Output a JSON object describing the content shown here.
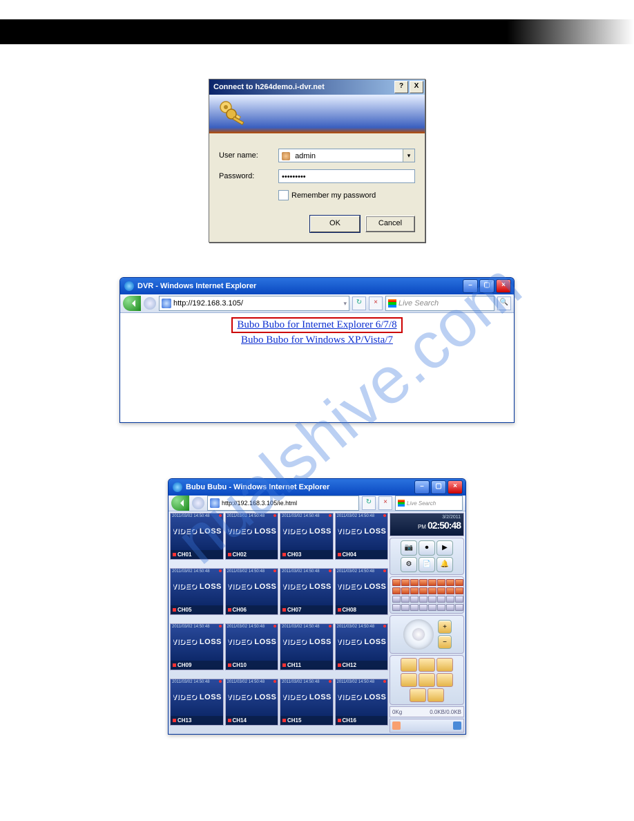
{
  "connect_dialog": {
    "title": "Connect to h264demo.i-dvr.net",
    "help_btn": "?",
    "close_btn": "X",
    "username_label": "User name:",
    "username_value": "admin",
    "password_label": "Password:",
    "password_value": "•••••••••",
    "remember_label": "Remember my password",
    "ok_label": "OK",
    "cancel_label": "Cancel"
  },
  "ie1": {
    "title": "DVR - Windows Internet Explorer",
    "url": "http://192.168.3.105/",
    "search_placeholder": "Live Search",
    "link1": "Bubo Bubo for Internet Explorer 6/7/8",
    "link2": "Bubo Bubo for Windows XP/Vista/7"
  },
  "ie2": {
    "title": "Bubu Bubu - Windows Internet Explorer",
    "url": "http://192.168.3.105/ie.html",
    "search_placeholder": "Live Search",
    "clock_date": "3/2/2011",
    "clock_pm": "PM",
    "clock_time": "02:50:48",
    "status_left": "0Kg",
    "status_right": "0.0KB/0.0KB",
    "timestamp": "2011/03/02 14:50:48",
    "channels": [
      {
        "name": "CH01",
        "loss": true
      },
      {
        "name": "CH02",
        "loss": true
      },
      {
        "name": "CH03",
        "loss": true
      },
      {
        "name": "CH04",
        "loss": true
      },
      {
        "name": "CH05",
        "loss": true
      },
      {
        "name": "CH06",
        "loss": true
      },
      {
        "name": "CH07",
        "loss": true
      },
      {
        "name": "CH08",
        "loss": true
      },
      {
        "name": "CH09",
        "loss": true
      },
      {
        "name": "CH10",
        "loss": true
      },
      {
        "name": "CH11",
        "loss": true
      },
      {
        "name": "CH12",
        "loss": true
      },
      {
        "name": "CH13",
        "loss": true
      },
      {
        "name": "CH14",
        "loss": true
      },
      {
        "name": "CH15",
        "loss": true
      },
      {
        "name": "CH16",
        "loss": true
      }
    ],
    "video_label": "VIDEO",
    "loss_label": "LOSS"
  },
  "watermark": "nualshive.com"
}
